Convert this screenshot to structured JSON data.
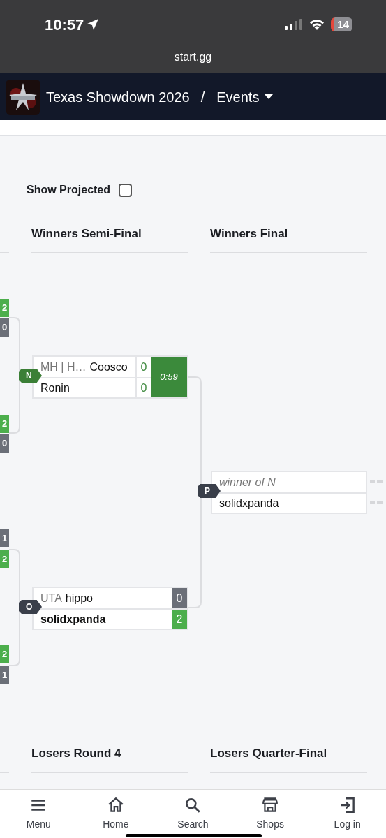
{
  "status_bar": {
    "time": "10:57",
    "battery": "14"
  },
  "address_bar": {
    "url": "start.gg"
  },
  "navbar": {
    "title": "Texas Showdown 2026",
    "separator": "/",
    "menu": "Events"
  },
  "show_projected": {
    "label": "Show Projected",
    "checked": false
  },
  "round_headers": [
    {
      "title": "Winners Semi-Final"
    },
    {
      "title": "Winners Final"
    }
  ],
  "edge_scores": [
    {
      "score": "2",
      "winner": true
    },
    {
      "score": "0",
      "winner": false
    },
    {
      "score": "2",
      "winner": true
    },
    {
      "score": "0",
      "winner": false
    },
    {
      "score": "1",
      "winner": false
    },
    {
      "score": "2",
      "winner": true
    },
    {
      "score": "2",
      "winner": true
    },
    {
      "score": "1",
      "winner": false
    }
  ],
  "sets": [
    {
      "badge": "N",
      "kind": "live",
      "timer": "0:59",
      "players": [
        {
          "kind": "player",
          "prefix": "MH | H…",
          "name": "Coosco",
          "score": "0"
        },
        {
          "kind": "player",
          "name": "Ronin",
          "score": "0"
        }
      ]
    },
    {
      "badge": "P",
      "kind": "pending",
      "players": [
        {
          "kind": "placeholder",
          "name": "winner of N"
        },
        {
          "kind": "player",
          "name": "solidxpanda"
        }
      ]
    },
    {
      "badge": "O",
      "kind": "completed",
      "players": [
        {
          "kind": "player",
          "prefix": "UTA",
          "name": "hippo",
          "score": "0",
          "winner": false
        },
        {
          "kind": "player",
          "name": "solidxpanda",
          "score": "2",
          "winner": true
        }
      ]
    }
  ],
  "losers_headers": [
    {
      "title": "Losers Round 4"
    },
    {
      "title": "Losers Quarter-Final"
    }
  ],
  "bottom_nav": [
    {
      "label": "Menu",
      "kind": "menu"
    },
    {
      "label": "Home",
      "kind": "home"
    },
    {
      "label": "Search",
      "kind": "search"
    },
    {
      "label": "Shops",
      "kind": "shop"
    },
    {
      "label": "Log in",
      "kind": "login"
    }
  ]
}
